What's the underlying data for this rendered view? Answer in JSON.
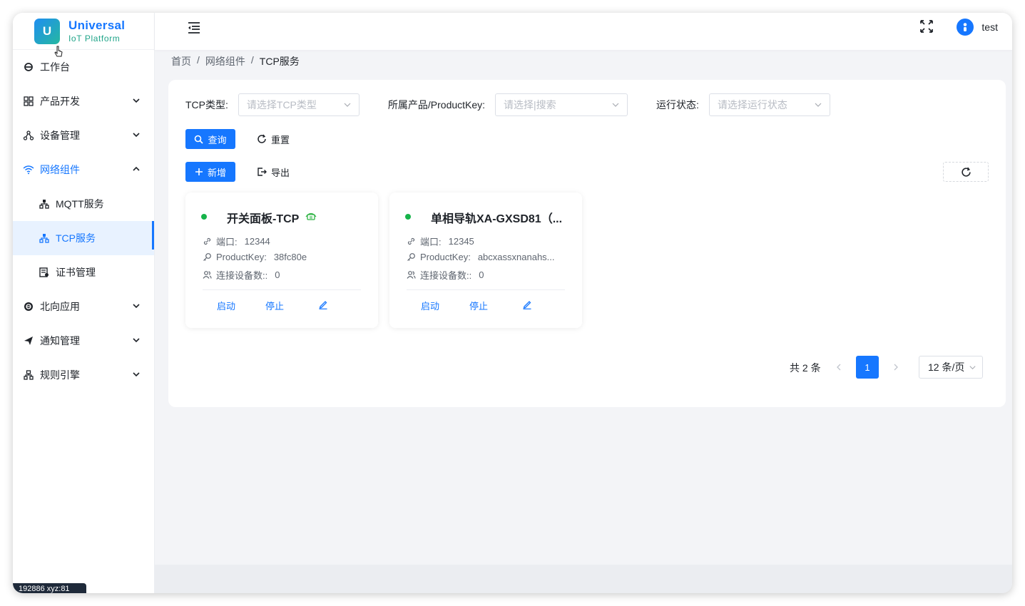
{
  "app": {
    "logo_letter": "U",
    "title": "Universal",
    "subtitle": "IoT Platform"
  },
  "header": {
    "username": "test"
  },
  "sidebar": {
    "items": [
      {
        "label": "工作台",
        "icon": "workbench-icon"
      },
      {
        "label": "产品开发",
        "icon": "product-icon"
      },
      {
        "label": "设备管理",
        "icon": "device-icon"
      },
      {
        "label": "网络组件",
        "icon": "wifi-icon"
      },
      {
        "label": "MQTT服务",
        "icon": "node-icon"
      },
      {
        "label": "TCP服务",
        "icon": "node-icon"
      },
      {
        "label": "证书管理",
        "icon": "certificate-icon"
      },
      {
        "label": "北向应用",
        "icon": "app-icon"
      },
      {
        "label": "通知管理",
        "icon": "send-icon"
      },
      {
        "label": "规则引擎",
        "icon": "rule-icon"
      }
    ],
    "status_text": "192886 xyz:81"
  },
  "breadcrumb": {
    "home": "首页",
    "section": "网络组件",
    "current": "TCP服务"
  },
  "filters": {
    "type_label": "TCP类型:",
    "type_placeholder": "请选择TCP类型",
    "product_label": "所属产品/ProductKey:",
    "product_placeholder": "请选择|搜索",
    "status_label": "运行状态:",
    "status_placeholder": "请选择运行状态"
  },
  "actions": {
    "search": "查询",
    "reset": "重置",
    "add": "新增",
    "export": "导出"
  },
  "cards": [
    {
      "name": "开关面板-TCP",
      "port_label": "端口:",
      "port": "12344",
      "key_label": "ProductKey:",
      "key": "38fc80e",
      "devices_label": "连接设备数::",
      "devices": "0",
      "start": "启动",
      "stop": "停止"
    },
    {
      "name": "单相导轨XA-GXSD81（...",
      "port_label": "端口:",
      "port": "12345",
      "key_label": "ProductKey:",
      "key": "abcxassxnanahs...",
      "devices_label": "连接设备数::",
      "devices": "0",
      "start": "启动",
      "stop": "停止"
    }
  ],
  "pagination": {
    "total": "共 2 条",
    "current_page": "1",
    "page_size": "12 条/页"
  },
  "colors": {
    "primary": "#1677ff",
    "online": "#16b34a"
  }
}
